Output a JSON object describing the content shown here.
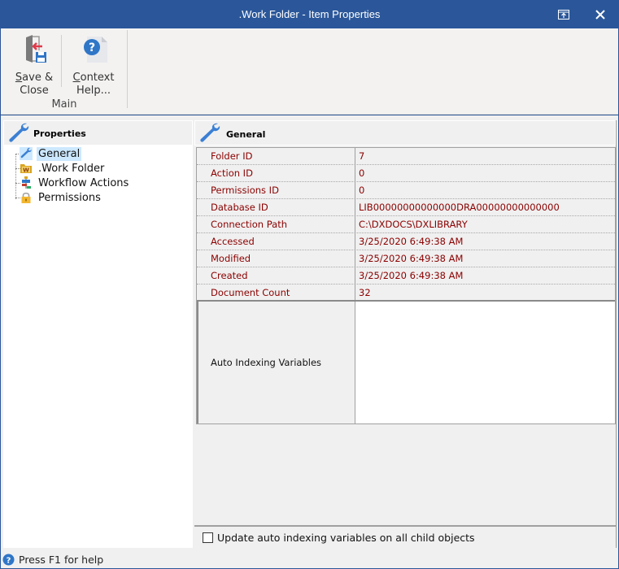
{
  "window": {
    "title": ".Work Folder - Item Properties"
  },
  "ribbon": {
    "buttons": [
      {
        "label_line1_accel": "S",
        "label_line1_rest": "ave &",
        "label_line2": "Close",
        "icon": "save-close-icon"
      },
      {
        "label_line1_accel": "C",
        "label_line1_rest": "ontext",
        "label_line2": "Help...",
        "icon": "context-help-icon"
      }
    ],
    "group_label": "Main"
  },
  "left_panel": {
    "header": "Properties",
    "items": [
      {
        "label": "General",
        "icon": "wrench-icon",
        "selected": true
      },
      {
        "label": ".Work Folder",
        "icon": "work-folder-icon",
        "selected": false
      },
      {
        "label": "Workflow Actions",
        "icon": "workflow-icon",
        "selected": false
      },
      {
        "label": "Permissions",
        "icon": "lock-icon",
        "selected": false
      }
    ]
  },
  "right_panel": {
    "header": "General",
    "rows": [
      {
        "key": "Folder ID",
        "value": "7"
      },
      {
        "key": "Action ID",
        "value": "0"
      },
      {
        "key": "Permissions ID",
        "value": "0"
      },
      {
        "key": "Database ID",
        "value": "LIB00000000000000DRA00000000000000"
      },
      {
        "key": "Connection Path",
        "value": "C:\\DXDOCS\\DXLIBRARY"
      },
      {
        "key": "Accessed",
        "value": "3/25/2020 6:49:38 AM"
      },
      {
        "key": "Modified",
        "value": "3/25/2020 6:49:38 AM"
      },
      {
        "key": "Created",
        "value": "3/25/2020 6:49:38 AM"
      },
      {
        "key": "Document Count",
        "value": "32"
      }
    ],
    "memo": {
      "key": "Auto Indexing Variables",
      "value": ""
    },
    "checkbox": {
      "label": "Update auto indexing variables on all child objects",
      "checked": false
    }
  },
  "status_bar": {
    "text": "Press F1 for help"
  },
  "colors": {
    "titlebar": "#2b579a",
    "value_text": "#8b0000",
    "selection": "#cce8ff"
  }
}
